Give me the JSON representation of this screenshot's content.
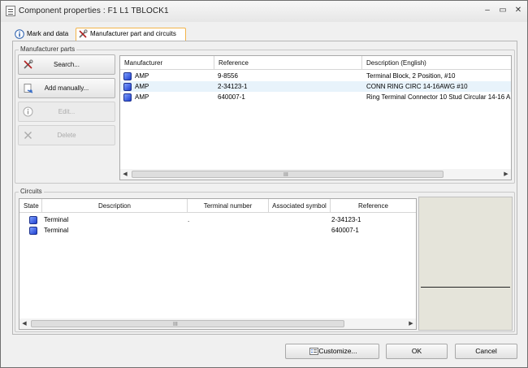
{
  "window": {
    "title": "Component properties : F1 L1 TBLOCK1",
    "controls": {
      "minimize": "–",
      "maximize": "▭",
      "close": "✕"
    }
  },
  "tabs": [
    {
      "label": "Mark and data",
      "icon": "info-icon",
      "active": false
    },
    {
      "label": "Manufacturer part and circuits",
      "icon": "tools-icon",
      "active": true
    }
  ],
  "manufacturer_parts": {
    "group_label": "Manufacturer parts",
    "buttons": [
      {
        "label": "Search...",
        "icon": "tools-icon",
        "enabled": true
      },
      {
        "label": "Add manually...",
        "icon": "add-manual-icon",
        "enabled": true
      },
      {
        "label": "Edit...",
        "icon": "info-icon",
        "enabled": false
      },
      {
        "label": "Delete",
        "icon": "delete-icon",
        "enabled": false
      }
    ],
    "columns": [
      "Manufacturer",
      "Reference",
      "Description (English)"
    ],
    "rows": [
      {
        "manufacturer": "AMP",
        "reference": "9-8556",
        "description": "Terminal Block, 2 Position, #10"
      },
      {
        "manufacturer": "AMP",
        "reference": "2-34123-1",
        "description": "CONN RING CIRC 14-16AWG #10"
      },
      {
        "manufacturer": "AMP",
        "reference": "640007-1",
        "description": "Ring Terminal Connector 10 Stud Circular 14-16 A"
      }
    ],
    "scroll": {
      "left": "◀",
      "right": "▶",
      "grip": "III"
    }
  },
  "circuits": {
    "group_label": "Circuits",
    "columns": [
      "State",
      "Description",
      "Terminal number",
      "Associated symbol",
      "Reference"
    ],
    "rows": [
      {
        "description": "Terminal",
        "terminal_number": ".",
        "associated_symbol": "",
        "reference": "2-34123-1"
      },
      {
        "description": "Terminal",
        "terminal_number": "",
        "associated_symbol": "",
        "reference": "640007-1"
      }
    ],
    "scroll": {
      "left": "◀",
      "right": "▶",
      "grip": "III"
    }
  },
  "footer": {
    "customize_label": "Customize...",
    "ok_label": "OK",
    "cancel_label": "Cancel"
  },
  "colors": {
    "accent_tab_border": "#f3b44a",
    "row_icon": "#1f3fcf",
    "preview_bg": "#e5e4da"
  }
}
